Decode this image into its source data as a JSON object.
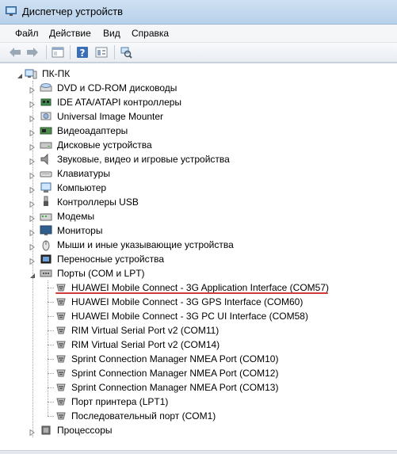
{
  "window": {
    "title": "Диспетчер устройств"
  },
  "menu": {
    "file": "Файл",
    "action": "Действие",
    "view": "Вид",
    "help": "Справка"
  },
  "toolbar": {
    "buttons": [
      "back-arrow-icon",
      "forward-arrow-icon",
      "properties-icon",
      "help-icon",
      "view-icon",
      "scan-hardware-icon"
    ]
  },
  "tree": {
    "root": "ПК-ПК",
    "categories": [
      {
        "label": "DVD и CD-ROM дисководы",
        "icon": "dvd-drive-icon",
        "expanded": false
      },
      {
        "label": "IDE ATA/ATAPI контроллеры",
        "icon": "ide-controller-icon",
        "expanded": false
      },
      {
        "label": "Universal Image Mounter",
        "icon": "image-mounter-icon",
        "expanded": false
      },
      {
        "label": "Видеоадаптеры",
        "icon": "display-adapter-icon",
        "expanded": false
      },
      {
        "label": "Дисковые устройства",
        "icon": "disk-drive-icon",
        "expanded": false
      },
      {
        "label": "Звуковые, видео и игровые устройства",
        "icon": "speaker-icon",
        "expanded": false
      },
      {
        "label": "Клавиатуры",
        "icon": "keyboard-icon",
        "expanded": false
      },
      {
        "label": "Компьютер",
        "icon": "computer-icon",
        "expanded": false
      },
      {
        "label": "Контроллеры USB",
        "icon": "usb-icon",
        "expanded": false
      },
      {
        "label": "Модемы",
        "icon": "modem-icon",
        "expanded": false
      },
      {
        "label": "Мониторы",
        "icon": "monitor-icon",
        "expanded": false
      },
      {
        "label": "Мыши и иные указывающие устройства",
        "icon": "mouse-icon",
        "expanded": false
      },
      {
        "label": "Переносные устройства",
        "icon": "portable-device-icon",
        "expanded": false
      },
      {
        "label": "Порты (COM и LPT)",
        "icon": "port-icon",
        "expanded": true
      }
    ],
    "ports": [
      "HUAWEI Mobile Connect - 3G Application Interface (COM57)",
      "HUAWEI Mobile Connect - 3G GPS Interface (COM60)",
      "HUAWEI Mobile Connect - 3G PC UI Interface (COM58)",
      "RIM Virtual Serial Port v2 (COM11)",
      "RIM Virtual Serial Port v2 (COM14)",
      "Sprint Connection Manager NMEA Port (COM10)",
      "Sprint Connection Manager NMEA Port (COM12)",
      "Sprint Connection Manager NMEA Port (COM13)",
      "Порт принтера (LPT1)",
      "Последовательный порт (COM1)"
    ],
    "after": [
      {
        "label": "Процессоры",
        "icon": "processor-icon",
        "expanded": false
      }
    ]
  },
  "colors": {
    "highlight_underline": "#d23b3b",
    "titlebar": "#c3d9f0"
  }
}
